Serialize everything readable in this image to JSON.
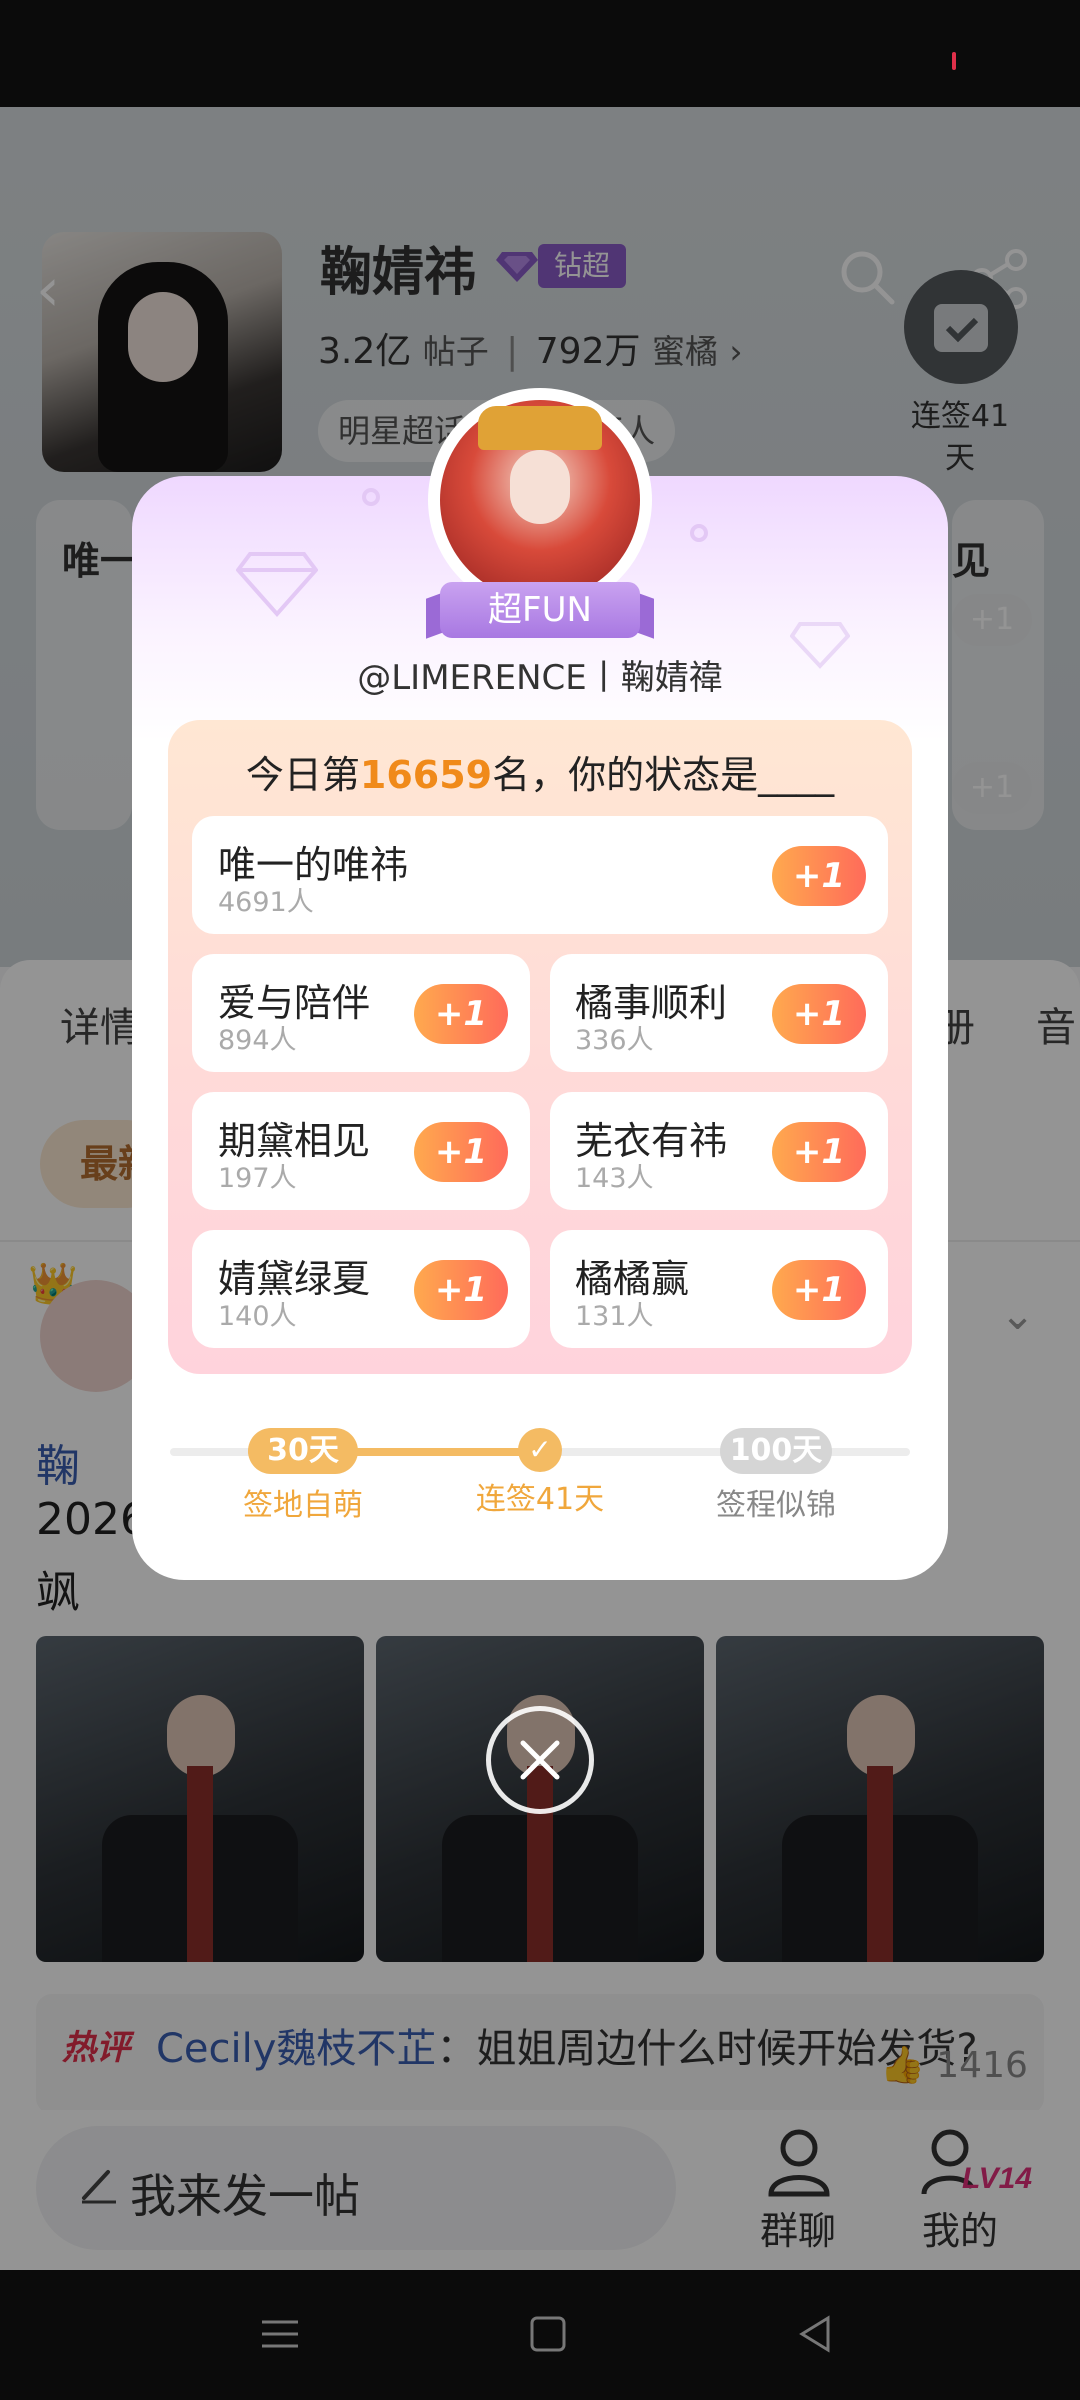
{
  "profile": {
    "name": "鞠婧祎",
    "badge": "钻超",
    "posts_count": "3.2亿",
    "posts_label": "帖子",
    "fans_count": "792万",
    "fans_label": "蜜橘",
    "chip_text": "明星超话  签到1.4万人",
    "checkin_label": "连签41天",
    "card_left_title": "唯一",
    "card_right_title": "见",
    "mini_plus": "+1"
  },
  "tabs": {
    "left": "详情",
    "right1": "册",
    "right2": "音"
  },
  "filter": {
    "latest": "最新"
  },
  "post": {
    "line1": "鞠",
    "line2": "2026",
    "line3": "飒"
  },
  "comment": {
    "hot": "热评",
    "user": "Cecily魏枝不芷",
    "text": "：姐姐周边什么时候开始发货?",
    "likes": "1416"
  },
  "bottom": {
    "post_input": "我来发一帖",
    "group_chat": "群聊",
    "mine": "我的",
    "level": "LV14"
  },
  "modal": {
    "ribbon": "超FUN",
    "handle": "@LIMERENCE丨鞠婧禕",
    "title_prefix": "今日第",
    "rank": "16659",
    "title_suffix": "名，你的状态是____",
    "options": [
      {
        "name": "唯一的唯祎",
        "count": "4691人",
        "button": "+1"
      },
      {
        "name": "爱与陪伴",
        "count": "894人",
        "button": "+1"
      },
      {
        "name": "橘事顺利",
        "count": "336人",
        "button": "+1"
      },
      {
        "name": "期黛相见",
        "count": "197人",
        "button": "+1"
      },
      {
        "name": "芜衣有祎",
        "count": "143人",
        "button": "+1"
      },
      {
        "name": "婧黛绿夏",
        "count": "140人",
        "button": "+1"
      },
      {
        "name": "橘橘赢",
        "count": "131人",
        "button": "+1"
      }
    ],
    "progress": {
      "start_badge": "30天",
      "start_label": "签地自萌",
      "current_label": "连签41天",
      "end_badge": "100天",
      "end_label": "签程似锦"
    }
  },
  "colors": {
    "accent_orange": "#f08a1a",
    "plus_gradient_start": "#ffa94e",
    "plus_gradient_end": "#ff6b5a",
    "link_blue": "#3a5db0"
  }
}
